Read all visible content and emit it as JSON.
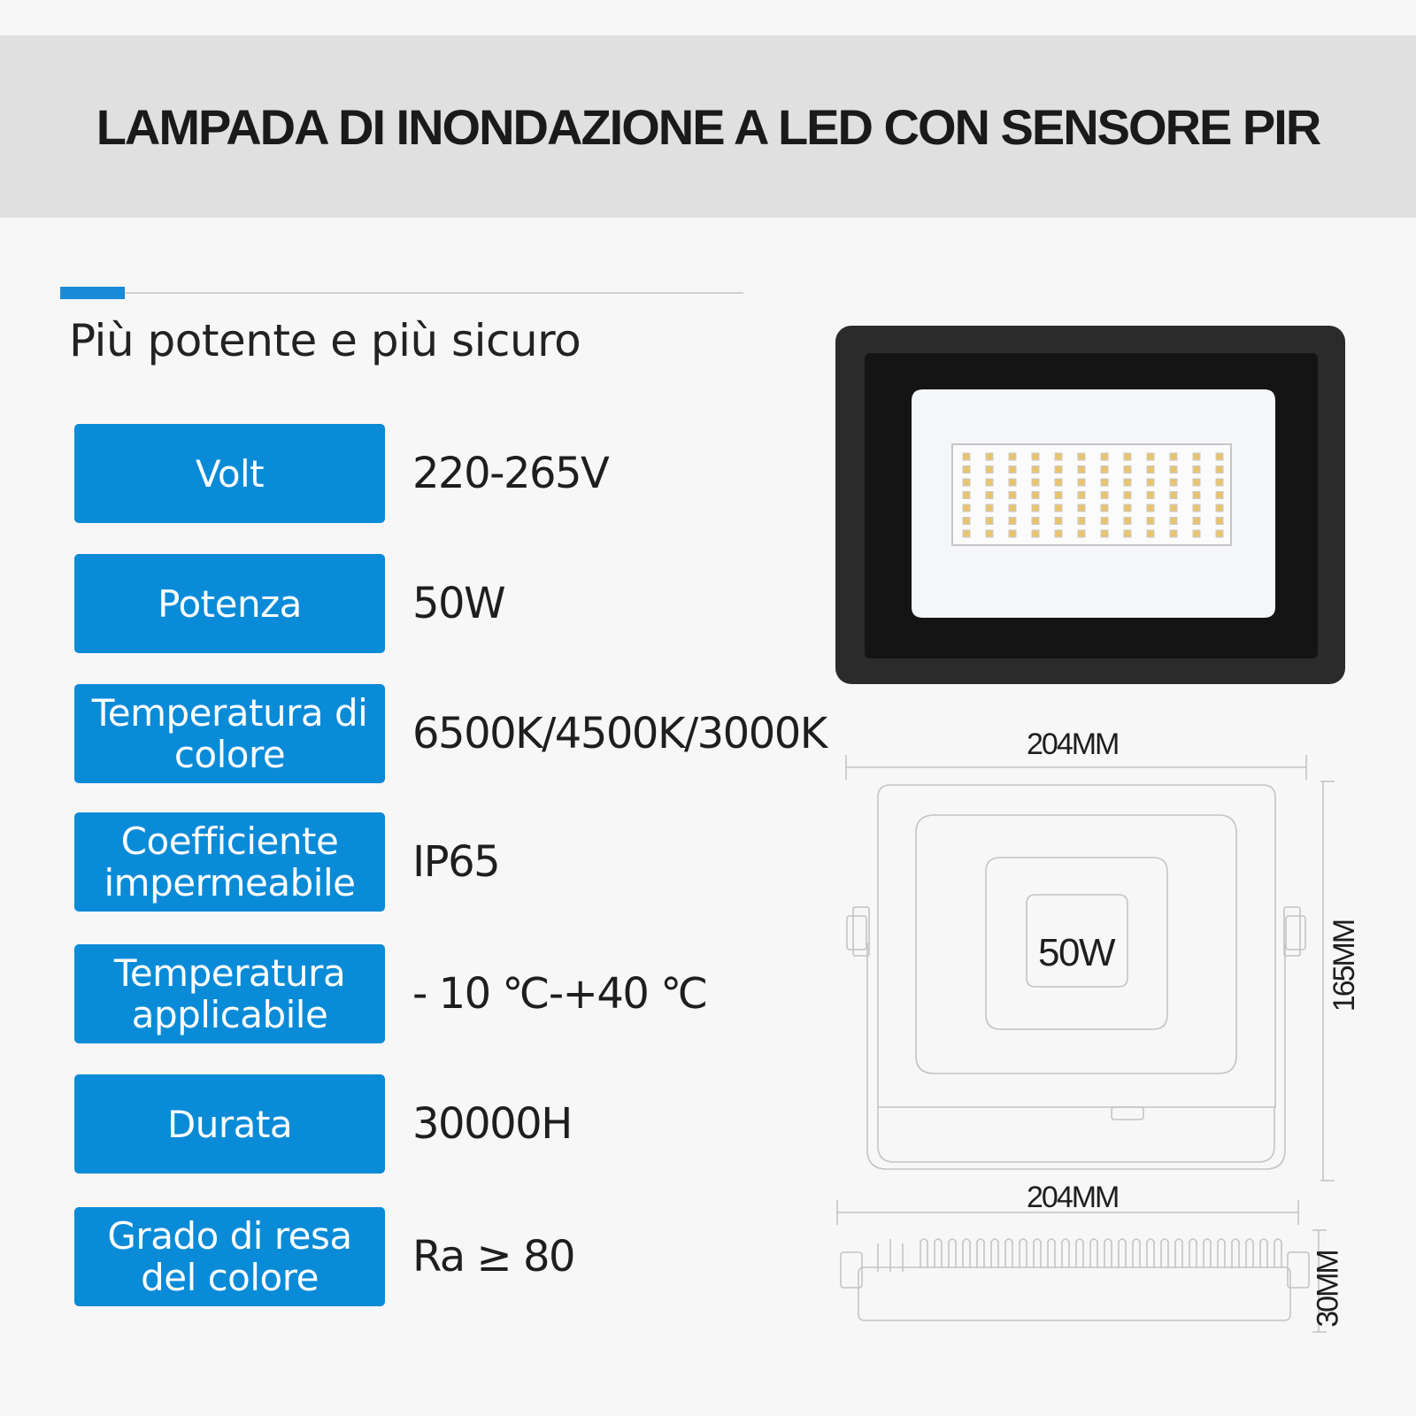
{
  "header": {
    "title": "LAMPADA DI INONDAZIONE A LED CON SENSORE PIR"
  },
  "section": {
    "subtitle": "Più potente e più sicuro"
  },
  "accent_color": "#0a8bd8",
  "specs": [
    {
      "label": "Volt",
      "value": "220-265V"
    },
    {
      "label": "Potenza",
      "value": "50W"
    },
    {
      "label": "Temperatura di colore",
      "value": "6500K/4500K/3000K"
    },
    {
      "label": "Coefficiente impermeabile",
      "value": "IP65"
    },
    {
      "label": "Temperatura applicabile",
      "value": "- 10 ℃-+40 ℃"
    },
    {
      "label": "Durata",
      "value": "30000H"
    },
    {
      "label": "Grado di resa del colore",
      "value": "Ra ≥ 80"
    }
  ],
  "diagram": {
    "front_width": "204MM",
    "height": "165MM",
    "center_label": "50W",
    "side_width": "204MM",
    "depth": "30MM"
  }
}
